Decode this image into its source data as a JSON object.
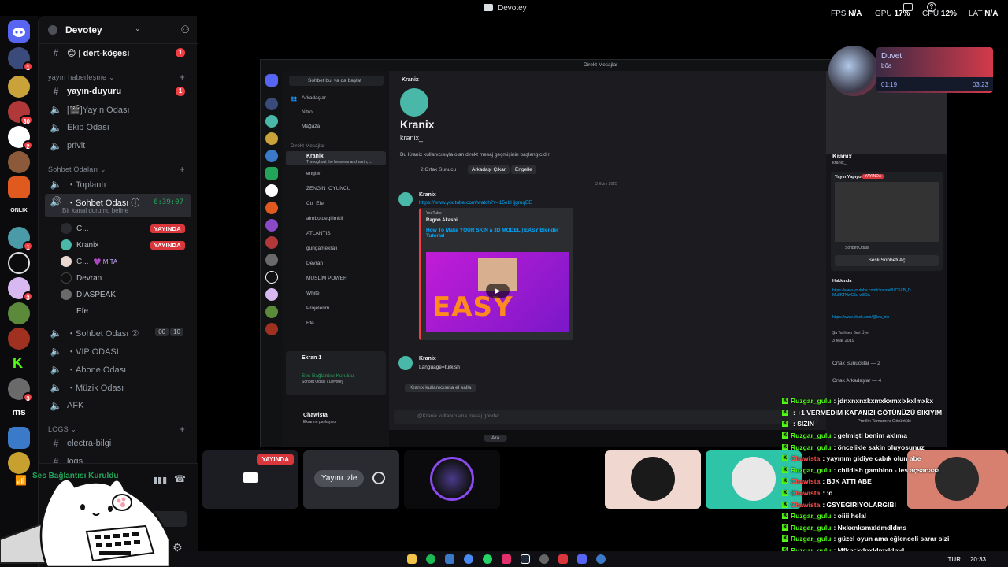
{
  "window": {
    "title": "Devotey"
  },
  "perf": {
    "fps_label": "FPS",
    "fps_val": "N/A",
    "gpu_label": "GPU",
    "gpu_val": "17%",
    "cpu_label": "CPU",
    "cpu_val": "12%",
    "lat_label": "LAT",
    "lat_val": "N/A"
  },
  "server": {
    "name": "Devotey"
  },
  "rail": {
    "badges": [
      "1",
      "30",
      "2",
      "1",
      "3",
      "3"
    ],
    "labels": [
      "ms"
    ]
  },
  "channels": {
    "top": {
      "name": "😊 | dert-köşesi",
      "count": "1"
    },
    "cat1": "yayın haberleşme",
    "yayin_duyuru": {
      "name": "yayın-duyuru",
      "count": "1"
    },
    "yayin_odasi": "[🎬]Yayın Odası",
    "ekip": "Ekip Odası",
    "privit": "privit",
    "cat2": "Sohbet Odaları",
    "toplanti": "・Toplantı",
    "sohbet1": {
      "name": "・Sohbet Odası ⓘ",
      "status": "Bir kanal durumu belirle",
      "timer": "6:39:07"
    },
    "users": [
      {
        "name": "C...",
        "live": "YAYINDA"
      },
      {
        "name": "Kranix",
        "live": "YAYINDA"
      },
      {
        "name": "C...",
        "badge": "💜 MİTA"
      },
      {
        "name": "Devran"
      },
      {
        "name": "DİASPEAK"
      },
      {
        "name": "Efe"
      }
    ],
    "sohbet2": {
      "name": "・Sohbet Odası ②",
      "a": "00",
      "b": "10"
    },
    "vip": "・VIP ODASI",
    "abone": "・Abone Odası",
    "muzik": "・Müzik Odası",
    "afk": "AFK",
    "cat3": "LOGS",
    "electra": "electra-bilgi",
    "logs": "logs"
  },
  "voice": {
    "connected": "Ses Bağlantısı Kuruldu"
  },
  "stream": {
    "search_btn": "Sohbet bul ya da başlat",
    "friends": "Arkadaşlar",
    "nitro": "Nitro",
    "shop": "Mağaza",
    "dm_header": "Direkt Mesajlar",
    "dms": [
      "Kranix",
      "engtw",
      "ZENGİN_OYUNCU",
      "Ctr_Efe",
      "aimbotdegilimkii",
      "ATLANTIS",
      "gungamekrali",
      "Devran",
      "MUSLİM POWER",
      "White",
      "Projelerim",
      "Efe"
    ],
    "dm_sub": "Throughout the heavens and earth, ...",
    "topbar_title": "Direkt Mesajlar",
    "chat_name": "Kranix",
    "big_name": "Kranix",
    "handle": "kranix_",
    "intro": "Bu Kranix kullanıcısıyla olan direkt mesaj geçmişinin başlangıcıdır.",
    "mutual": "2 Ortak Sunucu",
    "remove_friend": "Arkadaşı Çıkar",
    "block": "Engelle",
    "date1": "3 Ekim 2025",
    "msg1_author": "Kranix",
    "msg1_link": "https://www.youtube.com/watch?v=15ebHjgmqEE",
    "embed_provider": "YouTube",
    "embed_author": "Ragon Akashi",
    "embed_title": "How To Make YOUR SKIN a 3D MODEL | EASY Blender Tutorial",
    "easy_text": "EASY",
    "msg2_author": "Kranix",
    "msg2_text": "Language=turkish",
    "wave_text": "Kranix kullanıcısına el salla",
    "input_ph": "@Kranix kullanıcısına mesaj gönder",
    "self_name": "Chawista",
    "self_sub": "Ekranını paylaşıyor",
    "screen_title": "Ekran 1",
    "screen_conn": "Ses Bağlantısı Kuruldu",
    "screen_sub": "Sohbet Odası / Devotey",
    "prof_name": "Kranix",
    "prof_handle": "kranix_",
    "prof_live": "Yayın Yapıyor",
    "prof_live_badge": "YAYINDA",
    "prof_voice": "Sohbet Odası",
    "prof_join": "Sesli Sohbeti Aç",
    "prof_about": "Hakkında",
    "prof_link1": "https://www.youtube.com/channel/UCSXB_D Mu8KTNwG5u-w8OA",
    "prof_link2": "https://www.tiktok.com/@kra_nix",
    "prof_since_label": "Şu Tarihten Beri Üye:",
    "prof_since": "3 Mar 2019",
    "prof_servers": "Ortak Sunucular — 2",
    "prof_friends": "Ortak Arkadaşlar — 4",
    "prof_full": "Profilin Tamamını Görüntüle",
    "search_pill": "Ara"
  },
  "music": {
    "title": "Duvet",
    "artist": "bôa",
    "elapsed": "01:19",
    "total": "03:23",
    "progress": 0.39
  },
  "tiles": {
    "live": "YAYINDA",
    "watch": "Yayını izle"
  },
  "chat": [
    {
      "user": "Ruzgar_gulu",
      "text": ": jdnxnxnxkxmxkxmxlxkxlmxkx",
      "color": "#53fc18"
    },
    {
      "user": "",
      "text": ": +1 VERMEDİM KAFANIZI GÖTÜNÜZÜ SİKİYİM",
      "color": "#ff4d4d"
    },
    {
      "user": "",
      "text": ": SİZİN",
      "color": "#ff4d4d"
    },
    {
      "user": "Ruzgar_gulu",
      "text": ": gelmişti benim aklıma",
      "color": "#53fc18"
    },
    {
      "user": "Ruzgar_gulu",
      "text": ": öncelikle sakin oluyosunuz",
      "color": "#53fc18"
    },
    {
      "user": "Chawista",
      "text": ": yayınım gidiye cabık olun abe",
      "color": "#ff4d4d"
    },
    {
      "user": "Ruzgar_gulu",
      "text": ": childish gambino - les açsanaaa",
      "color": "#53fc18"
    },
    {
      "user": "Chawista",
      "text": ": BJK ATTI ABE",
      "color": "#ff4d4d"
    },
    {
      "user": "Chawista",
      "text": ": :d",
      "color": "#ff4d4d"
    },
    {
      "user": "Chawista",
      "text": ": GSYEGİRİYOLARGİBİ",
      "color": "#ff4d4d"
    },
    {
      "user": "Ruzgar_gulu",
      "text": ": oiiii helal",
      "color": "#53fc18"
    },
    {
      "user": "Ruzgar_gulu",
      "text": ": Nxkxnksmxldmdldms",
      "color": "#53fc18"
    },
    {
      "user": "Ruzgar_gulu",
      "text": ": güzel oyun ama eğlenceli sarar sizi",
      "color": "#53fc18"
    },
    {
      "user": "Ruzgar_gulu",
      "text": ": Mfknckdnxldmxldmd",
      "color": "#53fc18"
    },
    {
      "user": "Ruzgar_gulu",
      "text": ": yoruldum",
      "color": "#53fc18"
    }
  ],
  "taskbar": {
    "lang": "TUR",
    "time": "20:33"
  },
  "colors": {
    "accent": "#5865f2",
    "live": "#da373c",
    "online": "#23a559",
    "kick": "#53fc18"
  }
}
